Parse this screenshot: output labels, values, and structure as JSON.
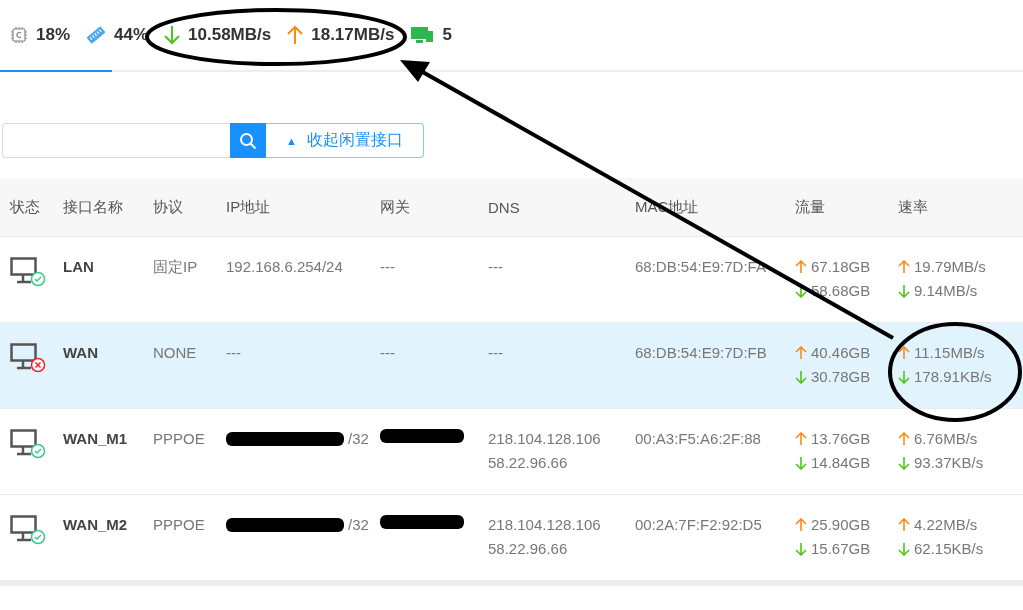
{
  "status_bar": [
    {
      "kind": "cpu",
      "value": "18%"
    },
    {
      "kind": "memory",
      "value": "44%"
    },
    {
      "kind": "download",
      "value": "10.58MB/s"
    },
    {
      "kind": "upload",
      "value": "18.17MB/s"
    },
    {
      "kind": "devices",
      "value": "5"
    }
  ],
  "toolbar": {
    "collapse_button": {
      "icon": "▲",
      "label": "收起闲置接口"
    }
  },
  "table": {
    "columns": [
      "状态",
      "接口名称",
      "协议",
      "IP地址",
      "网关",
      "DNS",
      "MAC地址",
      "流量",
      "速率"
    ],
    "rows": [
      {
        "connected": true,
        "selected": false,
        "name": "LAN",
        "protocol": "固定IP",
        "ip": "192.168.6.254/24",
        "gateway": "---",
        "dns": [
          "---"
        ],
        "mac": "68:DB:54:E9:7D:FA",
        "traffic_up": "67.18GB",
        "traffic_down": "58.68GB",
        "rate_up": "19.79MB/s",
        "rate_down": "9.14MB/s"
      },
      {
        "connected": false,
        "selected": true,
        "name": "WAN",
        "protocol": "NONE",
        "ip": "---",
        "gateway": "---",
        "dns": [
          "---"
        ],
        "mac": "68:DB:54:E9:7D:FB",
        "traffic_up": "40.46GB",
        "traffic_down": "30.78GB",
        "rate_up": "11.15MB/s",
        "rate_down": "178.91KB/s"
      },
      {
        "connected": true,
        "selected": false,
        "name": "WAN_M1",
        "protocol": "PPPOE",
        "ip": "/32",
        "ip_redacted": true,
        "gateway_redacted": true,
        "dns": [
          "218.104.128.106",
          "58.22.96.66"
        ],
        "mac": "00:A3:F5:A6:2F:88",
        "traffic_up": "13.76GB",
        "traffic_down": "14.84GB",
        "rate_up": "6.76MB/s",
        "rate_down": "93.37KB/s"
      },
      {
        "connected": true,
        "selected": false,
        "name": "WAN_M2",
        "protocol": "PPPOE",
        "ip": "/32",
        "ip_redacted": true,
        "gateway_redacted": true,
        "dns": [
          "218.104.128.106",
          "58.22.96.66"
        ],
        "mac": "00:2A:7F:F2:92:D5",
        "traffic_up": "25.90GB",
        "traffic_down": "15.67GB",
        "rate_up": "4.22MB/s",
        "rate_down": "62.15KB/s"
      }
    ]
  }
}
